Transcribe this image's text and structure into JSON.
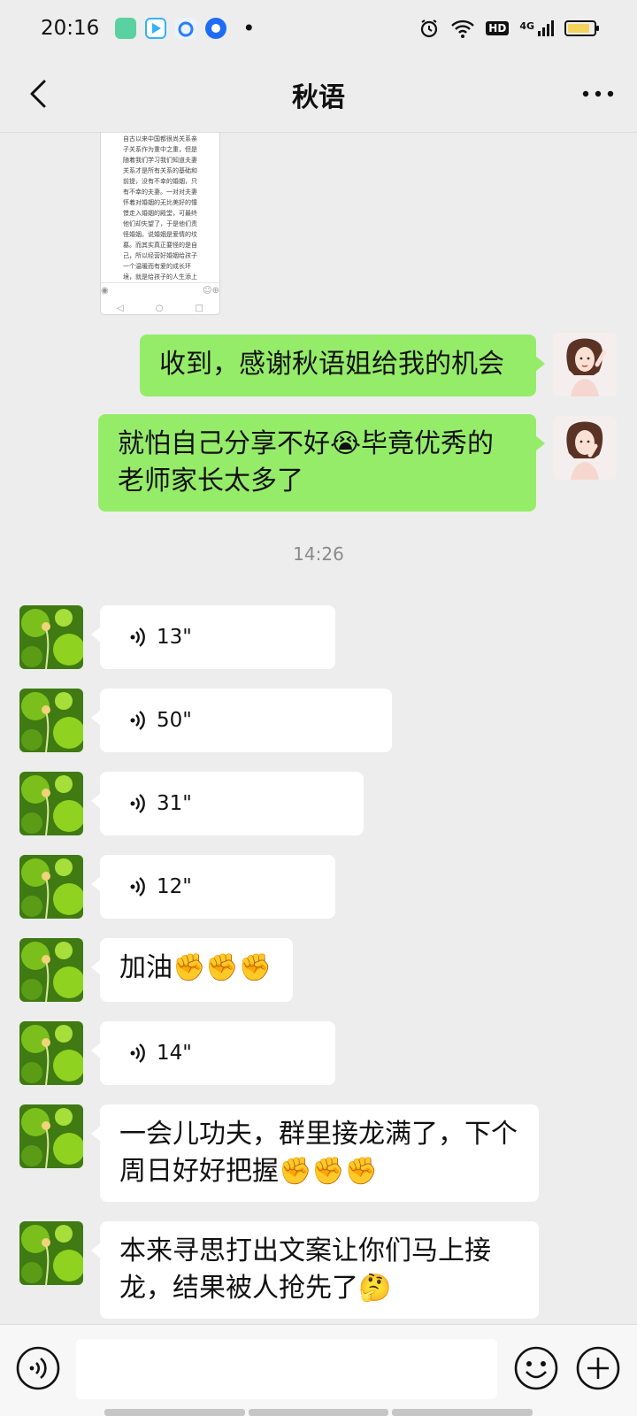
{
  "status_bar": {
    "time": "20:16",
    "apps": [
      {
        "icon": "green-app-icon",
        "color": "#5ad1a0"
      },
      {
        "icon": "video-app-icon",
        "color": "#35b1ff"
      },
      {
        "icon": "cloud-app-icon",
        "color": "#2a7dfb"
      },
      {
        "icon": "blue-app-icon",
        "color": "#1e6cf5"
      }
    ],
    "more": "•",
    "hd": "HD",
    "network": "4G",
    "battery_level": 0.85
  },
  "header": {
    "title": "秋语"
  },
  "doc_preview": {
    "text": "自古以来中国都很尚关系亲子关系作为重中之重，但是随着我们学习我们知道夫妻关系才是所有关系的基础和前提，没有不幸的婚姻，只有不幸的夫妻。一对对夫妻怀着对婚姻的无比美好的憧憬走入婚姻的殿堂，可最终他们却失望了，于是他们责怪婚姻。说婚姻是爱情的坟墓。而其实真正要怪的是自己，所以经营好婚姻给孩子一个温暖而有爱的成长环境，就是给孩子的人生添上温暖的底色。\n\n婚姻是个很难的课题，需要两个人共同经营。每个人在自己的婚姻要都有自己的幸"
  },
  "messages": [
    {
      "side": "out",
      "type": "text",
      "text": "收到，感谢秋语姐给我的机会"
    },
    {
      "side": "out",
      "type": "text",
      "text": "就怕自己分享不好😭毕竟优秀的老师家长太多了"
    },
    {
      "type": "time",
      "text": "14:26"
    },
    {
      "side": "in",
      "type": "voice",
      "duration": "13\""
    },
    {
      "side": "in",
      "type": "voice",
      "duration": "50\""
    },
    {
      "side": "in",
      "type": "voice",
      "duration": "31\""
    },
    {
      "side": "in",
      "type": "voice",
      "duration": "12\""
    },
    {
      "side": "in",
      "type": "text",
      "text": "加油✊✊✊"
    },
    {
      "side": "in",
      "type": "voice",
      "duration": "14\""
    },
    {
      "side": "in",
      "type": "text",
      "text": "一会儿功夫，群里接龙满了，下个周日好好把握✊✊✊"
    },
    {
      "side": "in",
      "type": "text",
      "text": "本来寻思打出文案让你们马上接龙，结果被人抢先了🤔"
    }
  ],
  "input_bar": {
    "placeholder": ""
  },
  "colors": {
    "background": "#ededed",
    "outgoing_bubble": "#95ec69",
    "incoming_bubble": "#ffffff"
  }
}
